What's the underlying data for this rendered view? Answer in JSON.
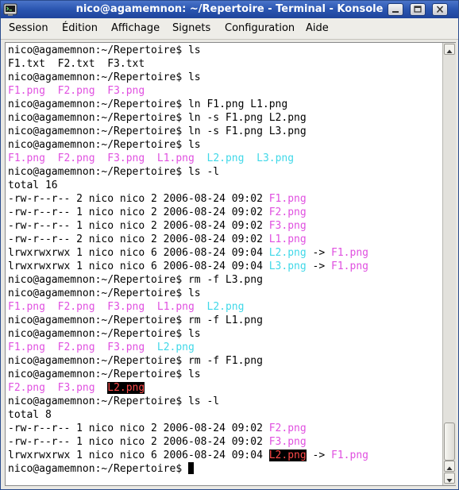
{
  "window": {
    "title": "nico@agamemnon: ~/Repertoire - Terminal - Konsole"
  },
  "menu": [
    "Session",
    "Édition",
    "Affichage",
    "Signets",
    "Configuration",
    "Aide"
  ],
  "colors": {
    "image_file": "#e050e0",
    "symlink": "#40d8e8",
    "orphan_link_bg": "#000000",
    "orphan_link_fg": "#ff4a4a",
    "titlebar": "#2a55b0"
  },
  "icons": {
    "app": "terminal-icon",
    "minimize": "minimize-icon",
    "maximize": "maximize-icon",
    "close": "close-icon"
  },
  "terminal": {
    "lines": [
      [
        {
          "t": "nico@agamemnon:~/Repertoire$ ls"
        }
      ],
      [
        {
          "t": "F1.txt  F2.txt  F3.txt"
        }
      ],
      [
        {
          "t": "nico@agamemnon:~/Repertoire$ ls"
        }
      ],
      [
        {
          "t": "F1.png",
          "c": "magenta"
        },
        {
          "t": "  "
        },
        {
          "t": "F2.png",
          "c": "magenta"
        },
        {
          "t": "  "
        },
        {
          "t": "F3.png",
          "c": "magenta"
        }
      ],
      [
        {
          "t": "nico@agamemnon:~/Repertoire$ ln F1.png L1.png"
        }
      ],
      [
        {
          "t": "nico@agamemnon:~/Repertoire$ ln -s F1.png L2.png"
        }
      ],
      [
        {
          "t": "nico@agamemnon:~/Repertoire$ ln -s F1.png L3.png"
        }
      ],
      [
        {
          "t": "nico@agamemnon:~/Repertoire$ ls"
        }
      ],
      [
        {
          "t": "F1.png",
          "c": "magenta"
        },
        {
          "t": "  "
        },
        {
          "t": "F2.png",
          "c": "magenta"
        },
        {
          "t": "  "
        },
        {
          "t": "F3.png",
          "c": "magenta"
        },
        {
          "t": "  "
        },
        {
          "t": "L1.png",
          "c": "magenta"
        },
        {
          "t": "  "
        },
        {
          "t": "L2.png",
          "c": "cyan"
        },
        {
          "t": "  "
        },
        {
          "t": "L3.png",
          "c": "cyan"
        }
      ],
      [
        {
          "t": "nico@agamemnon:~/Repertoire$ ls -l"
        }
      ],
      [
        {
          "t": "total 16"
        }
      ],
      [
        {
          "t": "-rw-r--r-- 2 nico nico 2 2006-08-24 09:02 "
        },
        {
          "t": "F1.png",
          "c": "magenta"
        }
      ],
      [
        {
          "t": "-rw-r--r-- 1 nico nico 2 2006-08-24 09:02 "
        },
        {
          "t": "F2.png",
          "c": "magenta"
        }
      ],
      [
        {
          "t": "-rw-r--r-- 1 nico nico 2 2006-08-24 09:02 "
        },
        {
          "t": "F3.png",
          "c": "magenta"
        }
      ],
      [
        {
          "t": "-rw-r--r-- 2 nico nico 2 2006-08-24 09:02 "
        },
        {
          "t": "L1.png",
          "c": "magenta"
        }
      ],
      [
        {
          "t": "lrwxrwxrwx 1 nico nico 6 2006-08-24 09:04 "
        },
        {
          "t": "L2.png",
          "c": "cyan"
        },
        {
          "t": " -> "
        },
        {
          "t": "F1.png",
          "c": "magenta"
        }
      ],
      [
        {
          "t": "lrwxrwxrwx 1 nico nico 6 2006-08-24 09:04 "
        },
        {
          "t": "L3.png",
          "c": "cyan"
        },
        {
          "t": " -> "
        },
        {
          "t": "F1.png",
          "c": "magenta"
        }
      ],
      [
        {
          "t": "nico@agamemnon:~/Repertoire$ rm -f L3.png"
        }
      ],
      [
        {
          "t": "nico@agamemnon:~/Repertoire$ ls"
        }
      ],
      [
        {
          "t": "F1.png",
          "c": "magenta"
        },
        {
          "t": "  "
        },
        {
          "t": "F2.png",
          "c": "magenta"
        },
        {
          "t": "  "
        },
        {
          "t": "F3.png",
          "c": "magenta"
        },
        {
          "t": "  "
        },
        {
          "t": "L1.png",
          "c": "magenta"
        },
        {
          "t": "  "
        },
        {
          "t": "L2.png",
          "c": "cyan"
        }
      ],
      [
        {
          "t": "nico@agamemnon:~/Repertoire$ rm -f L1.png"
        }
      ],
      [
        {
          "t": "nico@agamemnon:~/Repertoire$ ls"
        }
      ],
      [
        {
          "t": "F1.png",
          "c": "magenta"
        },
        {
          "t": "  "
        },
        {
          "t": "F2.png",
          "c": "magenta"
        },
        {
          "t": "  "
        },
        {
          "t": "F3.png",
          "c": "magenta"
        },
        {
          "t": "  "
        },
        {
          "t": "L2.png",
          "c": "cyan"
        }
      ],
      [
        {
          "t": "nico@agamemnon:~/Repertoire$ rm -f F1.png"
        }
      ],
      [
        {
          "t": "nico@agamemnon:~/Repertoire$ ls"
        }
      ],
      [
        {
          "t": "F2.png",
          "c": "magenta"
        },
        {
          "t": "  "
        },
        {
          "t": "F3.png",
          "c": "magenta"
        },
        {
          "t": "  "
        },
        {
          "t": "L2.png",
          "c": "orphan"
        }
      ],
      [
        {
          "t": "nico@agamemnon:~/Repertoire$ ls -l"
        }
      ],
      [
        {
          "t": "total 8"
        }
      ],
      [
        {
          "t": "-rw-r--r-- 1 nico nico 2 2006-08-24 09:02 "
        },
        {
          "t": "F2.png",
          "c": "magenta"
        }
      ],
      [
        {
          "t": "-rw-r--r-- 1 nico nico 2 2006-08-24 09:02 "
        },
        {
          "t": "F3.png",
          "c": "magenta"
        }
      ],
      [
        {
          "t": "lrwxrwxrwx 1 nico nico 6 2006-08-24 09:04 "
        },
        {
          "t": "L2.png",
          "c": "orphan"
        },
        {
          "t": " -> "
        },
        {
          "t": "F1.png",
          "c": "magenta"
        }
      ],
      [
        {
          "t": "nico@agamemnon:~/Repertoire$ "
        }
      ]
    ]
  }
}
